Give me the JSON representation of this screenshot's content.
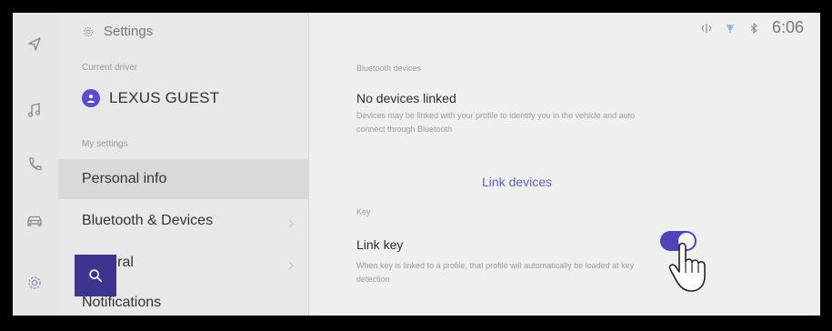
{
  "sidebar": {
    "header_title": "Settings",
    "current_driver_caption": "Current driver",
    "driver_name": "LEXUS GUEST",
    "my_settings_caption": "My settings",
    "items": [
      {
        "label": "Personal info",
        "active": true
      },
      {
        "label": "Bluetooth & Devices",
        "active": false
      },
      {
        "label": "General",
        "active": false
      },
      {
        "label": "Notifications",
        "active": false
      }
    ]
  },
  "rail": {
    "icons": [
      "navigation-icon",
      "music-icon",
      "phone-icon",
      "car-icon",
      "settings-icon"
    ]
  },
  "status_bar": {
    "time": "6:06",
    "icons": [
      "wireless-charging-icon",
      "signal-icon",
      "bluetooth-icon"
    ]
  },
  "content": {
    "bluetooth_caption": "Bluetooth devices",
    "no_devices_title": "No devices linked",
    "no_devices_desc": "Devices may be linked with your profile to identify you in the vehicle and auto connect through Bluetooth",
    "link_devices_label": "Link devices",
    "key_caption": "Key",
    "link_key_title": "Link key",
    "link_key_desc": "When key is linked to a profile, that profile will automatically be loaded at key detection",
    "link_key_enabled": true
  },
  "colors": {
    "accent": "#4e44b8",
    "link_text": "#5a62c8",
    "background": "#efefef"
  }
}
